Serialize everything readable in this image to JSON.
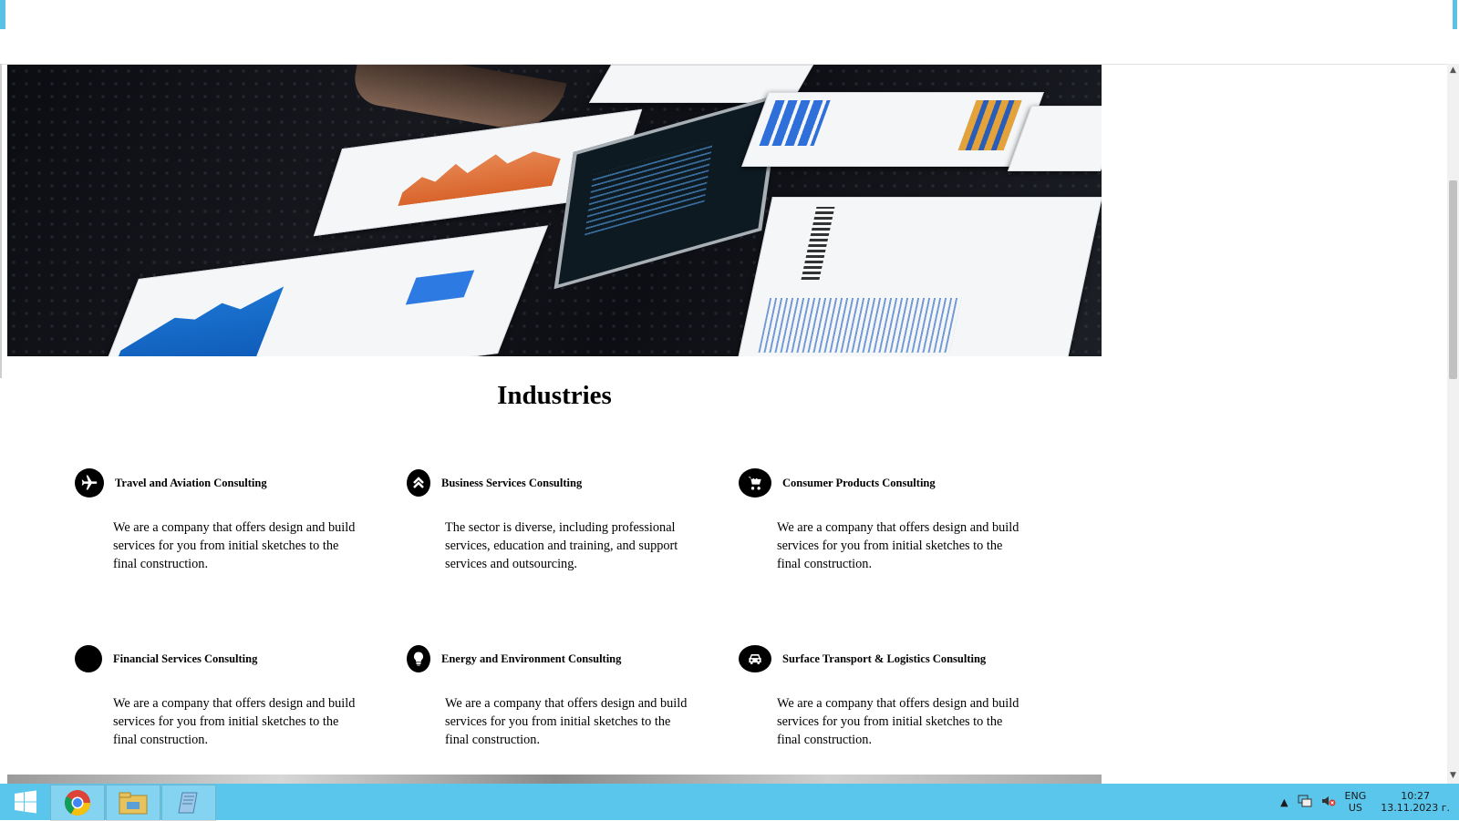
{
  "section": {
    "title": "Industries"
  },
  "industries": [
    {
      "title": "Travel and Aviation Consulting",
      "icon": "airplane-icon",
      "desc": "We are a company that offers design and build services for you from initial sketches to the final construction."
    },
    {
      "title": "Business Services Consulting",
      "icon": "double-chevron-up-icon",
      "desc": "The sector is diverse, including professional services, education and training, and support services and outsourcing."
    },
    {
      "title": "Consumer Products Consulting",
      "icon": "shopping-cart-icon",
      "desc": "We are a company that offers design and build services for you from initial sketches to the final construction."
    },
    {
      "title": "Financial Services Consulting",
      "icon": "circle-icon",
      "desc": "We are a company that offers design and build services for you from initial sketches to the final construction."
    },
    {
      "title": "Energy and Environment Consulting",
      "icon": "lightbulb-icon",
      "desc": "We are a company that offers design and build services for you from initial sketches to the final construction."
    },
    {
      "title": "Surface Transport & Logistics Consulting",
      "icon": "car-icon",
      "desc": "We are a company that offers design and build services for you from initial sketches to the final construction."
    }
  ],
  "taskbar": {
    "apps": [
      "windows-start-icon",
      "chrome-icon",
      "file-explorer-icon",
      "notepad-icon"
    ],
    "lang_top": "ENG",
    "lang_bottom": "US",
    "time": "10:27",
    "date": "13.11.2023 г."
  },
  "colors": {
    "taskbar": "#5bc6ec",
    "accent": "#5bc0e6"
  }
}
